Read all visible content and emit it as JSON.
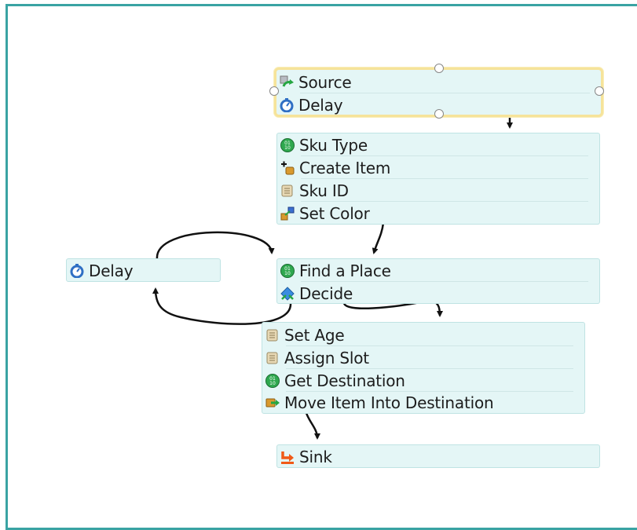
{
  "blocks": {
    "source": {
      "rows": [
        {
          "label": "Source",
          "icon": "source-icon"
        },
        {
          "label": "Delay",
          "icon": "delay-icon"
        }
      ]
    },
    "create": {
      "rows": [
        {
          "label": "Sku Type",
          "icon": "sku-type-icon"
        },
        {
          "label": "Create Item",
          "icon": "create-item-icon"
        },
        {
          "label": "Sku ID",
          "icon": "script-icon"
        },
        {
          "label": "Set Color",
          "icon": "set-color-icon"
        }
      ]
    },
    "find": {
      "rows": [
        {
          "label": "Find a Place",
          "icon": "sku-type-icon"
        },
        {
          "label": "Decide",
          "icon": "decide-icon"
        }
      ]
    },
    "side_delay": {
      "rows": [
        {
          "label": "Delay",
          "icon": "delay-icon"
        }
      ]
    },
    "move": {
      "rows": [
        {
          "label": "Set Age",
          "icon": "script-icon"
        },
        {
          "label": "Assign Slot",
          "icon": "script-icon"
        },
        {
          "label": "Get Destination",
          "icon": "sku-type-icon"
        },
        {
          "label": "Move Item Into Destination",
          "icon": "move-item-icon"
        }
      ]
    },
    "sink": {
      "rows": [
        {
          "label": "Sink",
          "icon": "sink-icon"
        }
      ]
    }
  },
  "colors": {
    "frame": "#3aa3a3",
    "block_bg": "#e4f6f6",
    "selection": "#f6e39a"
  }
}
